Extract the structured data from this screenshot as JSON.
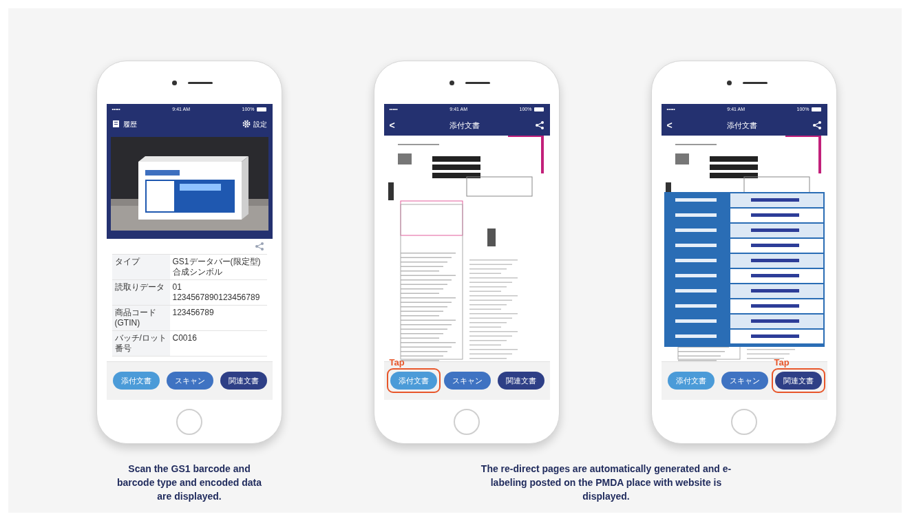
{
  "phones": [
    {
      "status_bar": {
        "signal": "•••••",
        "time": "9:41 AM",
        "battery": "100%"
      },
      "header": {
        "kind": "home",
        "left_label": "履歴",
        "right_label": "設定"
      },
      "content": {
        "kind": "scan",
        "rows": [
          {
            "label": "タイプ",
            "value": "GS1データバー(限定型)合成シンボル"
          },
          {
            "label": "読取りデータ",
            "value": "01 1234567890123456789"
          },
          {
            "label": "商品コード(GTIN)",
            "value": "123456789"
          },
          {
            "label": "バッチ/ロット番号",
            "value": "C0016"
          }
        ]
      },
      "buttons": [
        {
          "label": "添付文書",
          "color": "#4b9bd8",
          "tapped": false
        },
        {
          "label": "スキャン",
          "color": "#3f73c2",
          "tapped": false
        },
        {
          "label": "関連文書",
          "color": "#2e3f86",
          "tapped": false
        }
      ]
    },
    {
      "status_bar": {
        "signal": "•••••",
        "time": "9:41 AM",
        "battery": "100%"
      },
      "header": {
        "kind": "viewer",
        "back": "<",
        "title": "添付文書"
      },
      "content": {
        "kind": "document"
      },
      "buttons": [
        {
          "label": "添付文書",
          "color": "#4b9bd8",
          "tapped": true,
          "hint": "Tap"
        },
        {
          "label": "スキャン",
          "color": "#3f73c2",
          "tapped": false
        },
        {
          "label": "関連文書",
          "color": "#2e3f86",
          "tapped": false
        }
      ]
    },
    {
      "status_bar": {
        "signal": "•••••",
        "time": "9:41 AM",
        "battery": "100%"
      },
      "header": {
        "kind": "viewer",
        "back": "<",
        "title": "添付文書"
      },
      "content": {
        "kind": "document_table"
      },
      "buttons": [
        {
          "label": "添付文書",
          "color": "#4b9bd8",
          "tapped": false
        },
        {
          "label": "スキャン",
          "color": "#3f73c2",
          "tapped": false
        },
        {
          "label": "関連文書",
          "color": "#2e3f86",
          "tapped": true,
          "hint": "Tap"
        }
      ]
    }
  ],
  "captions": [
    "Scan the GS1 barcode and barcode type and encoded data are displayed.",
    "The re-direct pages are automatically generated and e-labeling posted on the PMDA place with website is displayed."
  ]
}
